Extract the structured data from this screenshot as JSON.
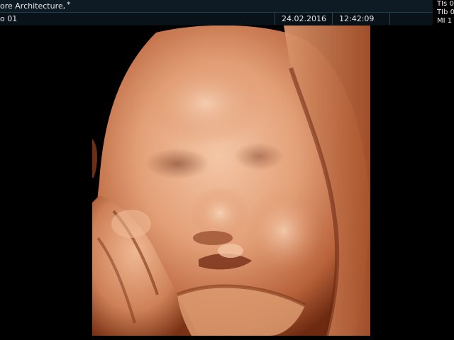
{
  "header": {
    "title": "ore Architecture,",
    "asterisk": "*",
    "probe": "o 01",
    "date": "24.02.2016",
    "time": "12:42:09"
  },
  "indices": {
    "line1": "TIs 0",
    "line2": "TIb 0",
    "line3": "MI 1"
  },
  "colors": {
    "skin_highlight": "#f3c2a1",
    "skin_mid": "#d98a5e",
    "skin_shadow": "#8a3a1a",
    "background": "#000000"
  }
}
